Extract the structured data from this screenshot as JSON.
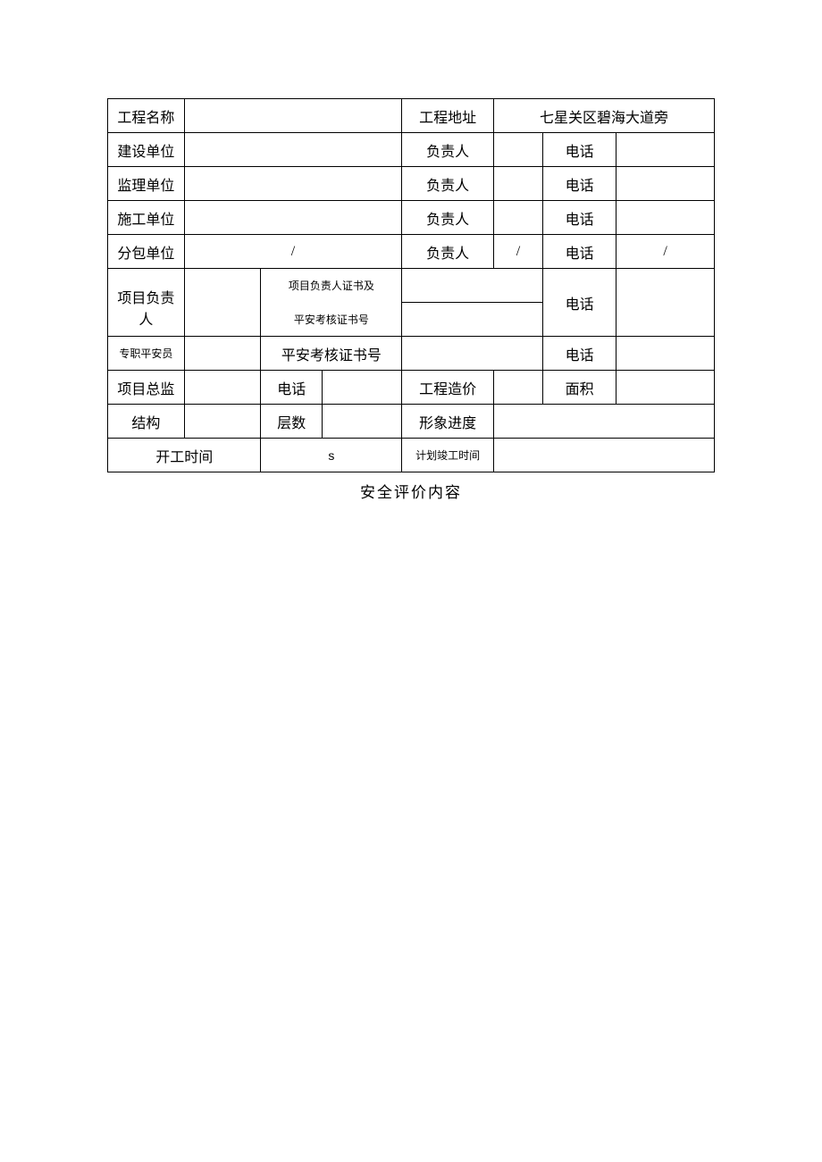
{
  "row1": {
    "c1": "工程名称",
    "c2": "",
    "c3": "工程地址",
    "c4": "七星关区碧海大道旁"
  },
  "row2": {
    "c1": "建设单位",
    "c2": "",
    "c3": "负责人",
    "c4": "",
    "c5": "电话",
    "c6": ""
  },
  "row3": {
    "c1": "监理单位",
    "c2": "",
    "c3": "负责人",
    "c4": "",
    "c5": "电话",
    "c6": ""
  },
  "row4": {
    "c1": "施工单位",
    "c2": "",
    "c3": "负责人",
    "c4": "",
    "c5": "电话",
    "c6": ""
  },
  "row5": {
    "c1": "分包单位",
    "c2": "/",
    "c3": "负责人",
    "c4": "/",
    "c5": "电话",
    "c6": "/"
  },
  "row6": {
    "c1": "项目负责人",
    "c2": "",
    "c3a": "项目负责人证书及",
    "c3b": "平安考核证书号",
    "c4": "",
    "c5": "电话",
    "c6": ""
  },
  "row7": {
    "c1": "专职平安员",
    "c2": "",
    "c3": "平安考核证书号",
    "c4": "",
    "c5": "电话",
    "c6": ""
  },
  "row8": {
    "c1": "项目总监",
    "c2": "",
    "c3": "电话",
    "c4": "",
    "c5": "工程造价",
    "c6": "",
    "c7": "面积",
    "c8": ""
  },
  "row9": {
    "c1": "结构",
    "c2": "",
    "c3": "层数",
    "c4": "",
    "c5": "形象进度",
    "c6": ""
  },
  "row10": {
    "c1": "开工时间",
    "c2": "s",
    "c3": "计划竣工时间",
    "c4": ""
  },
  "caption": "安全评价内容"
}
